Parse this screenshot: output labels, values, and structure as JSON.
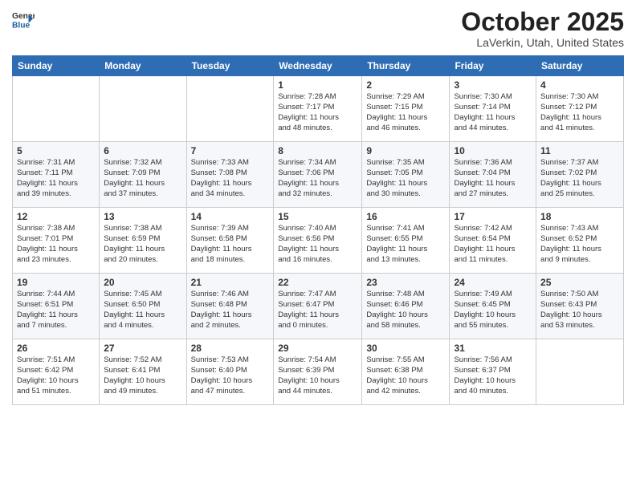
{
  "header": {
    "logo_general": "General",
    "logo_blue": "Blue",
    "month": "October 2025",
    "location": "LaVerkin, Utah, United States"
  },
  "weekdays": [
    "Sunday",
    "Monday",
    "Tuesday",
    "Wednesday",
    "Thursday",
    "Friday",
    "Saturday"
  ],
  "weeks": [
    [
      {
        "day": "",
        "info": ""
      },
      {
        "day": "",
        "info": ""
      },
      {
        "day": "",
        "info": ""
      },
      {
        "day": "1",
        "info": "Sunrise: 7:28 AM\nSunset: 7:17 PM\nDaylight: 11 hours\nand 48 minutes."
      },
      {
        "day": "2",
        "info": "Sunrise: 7:29 AM\nSunset: 7:15 PM\nDaylight: 11 hours\nand 46 minutes."
      },
      {
        "day": "3",
        "info": "Sunrise: 7:30 AM\nSunset: 7:14 PM\nDaylight: 11 hours\nand 44 minutes."
      },
      {
        "day": "4",
        "info": "Sunrise: 7:30 AM\nSunset: 7:12 PM\nDaylight: 11 hours\nand 41 minutes."
      }
    ],
    [
      {
        "day": "5",
        "info": "Sunrise: 7:31 AM\nSunset: 7:11 PM\nDaylight: 11 hours\nand 39 minutes."
      },
      {
        "day": "6",
        "info": "Sunrise: 7:32 AM\nSunset: 7:09 PM\nDaylight: 11 hours\nand 37 minutes."
      },
      {
        "day": "7",
        "info": "Sunrise: 7:33 AM\nSunset: 7:08 PM\nDaylight: 11 hours\nand 34 minutes."
      },
      {
        "day": "8",
        "info": "Sunrise: 7:34 AM\nSunset: 7:06 PM\nDaylight: 11 hours\nand 32 minutes."
      },
      {
        "day": "9",
        "info": "Sunrise: 7:35 AM\nSunset: 7:05 PM\nDaylight: 11 hours\nand 30 minutes."
      },
      {
        "day": "10",
        "info": "Sunrise: 7:36 AM\nSunset: 7:04 PM\nDaylight: 11 hours\nand 27 minutes."
      },
      {
        "day": "11",
        "info": "Sunrise: 7:37 AM\nSunset: 7:02 PM\nDaylight: 11 hours\nand 25 minutes."
      }
    ],
    [
      {
        "day": "12",
        "info": "Sunrise: 7:38 AM\nSunset: 7:01 PM\nDaylight: 11 hours\nand 23 minutes."
      },
      {
        "day": "13",
        "info": "Sunrise: 7:38 AM\nSunset: 6:59 PM\nDaylight: 11 hours\nand 20 minutes."
      },
      {
        "day": "14",
        "info": "Sunrise: 7:39 AM\nSunset: 6:58 PM\nDaylight: 11 hours\nand 18 minutes."
      },
      {
        "day": "15",
        "info": "Sunrise: 7:40 AM\nSunset: 6:56 PM\nDaylight: 11 hours\nand 16 minutes."
      },
      {
        "day": "16",
        "info": "Sunrise: 7:41 AM\nSunset: 6:55 PM\nDaylight: 11 hours\nand 13 minutes."
      },
      {
        "day": "17",
        "info": "Sunrise: 7:42 AM\nSunset: 6:54 PM\nDaylight: 11 hours\nand 11 minutes."
      },
      {
        "day": "18",
        "info": "Sunrise: 7:43 AM\nSunset: 6:52 PM\nDaylight: 11 hours\nand 9 minutes."
      }
    ],
    [
      {
        "day": "19",
        "info": "Sunrise: 7:44 AM\nSunset: 6:51 PM\nDaylight: 11 hours\nand 7 minutes."
      },
      {
        "day": "20",
        "info": "Sunrise: 7:45 AM\nSunset: 6:50 PM\nDaylight: 11 hours\nand 4 minutes."
      },
      {
        "day": "21",
        "info": "Sunrise: 7:46 AM\nSunset: 6:48 PM\nDaylight: 11 hours\nand 2 minutes."
      },
      {
        "day": "22",
        "info": "Sunrise: 7:47 AM\nSunset: 6:47 PM\nDaylight: 11 hours\nand 0 minutes."
      },
      {
        "day": "23",
        "info": "Sunrise: 7:48 AM\nSunset: 6:46 PM\nDaylight: 10 hours\nand 58 minutes."
      },
      {
        "day": "24",
        "info": "Sunrise: 7:49 AM\nSunset: 6:45 PM\nDaylight: 10 hours\nand 55 minutes."
      },
      {
        "day": "25",
        "info": "Sunrise: 7:50 AM\nSunset: 6:43 PM\nDaylight: 10 hours\nand 53 minutes."
      }
    ],
    [
      {
        "day": "26",
        "info": "Sunrise: 7:51 AM\nSunset: 6:42 PM\nDaylight: 10 hours\nand 51 minutes."
      },
      {
        "day": "27",
        "info": "Sunrise: 7:52 AM\nSunset: 6:41 PM\nDaylight: 10 hours\nand 49 minutes."
      },
      {
        "day": "28",
        "info": "Sunrise: 7:53 AM\nSunset: 6:40 PM\nDaylight: 10 hours\nand 47 minutes."
      },
      {
        "day": "29",
        "info": "Sunrise: 7:54 AM\nSunset: 6:39 PM\nDaylight: 10 hours\nand 44 minutes."
      },
      {
        "day": "30",
        "info": "Sunrise: 7:55 AM\nSunset: 6:38 PM\nDaylight: 10 hours\nand 42 minutes."
      },
      {
        "day": "31",
        "info": "Sunrise: 7:56 AM\nSunset: 6:37 PM\nDaylight: 10 hours\nand 40 minutes."
      },
      {
        "day": "",
        "info": ""
      }
    ]
  ]
}
